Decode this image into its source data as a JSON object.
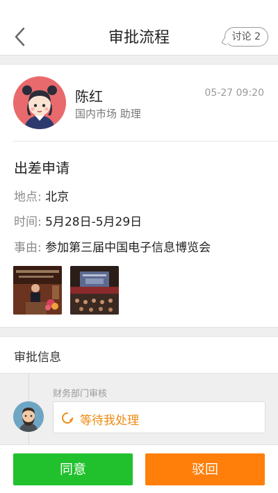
{
  "header": {
    "title": "审批流程",
    "discuss_label": "讨论 2"
  },
  "applicant": {
    "name": "陈红",
    "department": "国内市场 助理",
    "time": "05-27 09:20"
  },
  "application": {
    "type": "出差申请",
    "fields": [
      {
        "label": "地点:",
        "value": "北京"
      },
      {
        "label": "时间:",
        "value": "5月28日-5月29日"
      },
      {
        "label": "事由:",
        "value": "参加第三届中国电子信息博览会"
      }
    ]
  },
  "approval": {
    "section_title": "审批信息",
    "step_label": "财务部门审核",
    "status": "等待我处理"
  },
  "actions": {
    "agree_label": "同意",
    "reject_label": "驳回"
  },
  "colors": {
    "agree": "#21c12d",
    "reject": "#ff7f0a",
    "pending": "#f08a12",
    "applicant_avatar_bg": "#e86a6c"
  }
}
